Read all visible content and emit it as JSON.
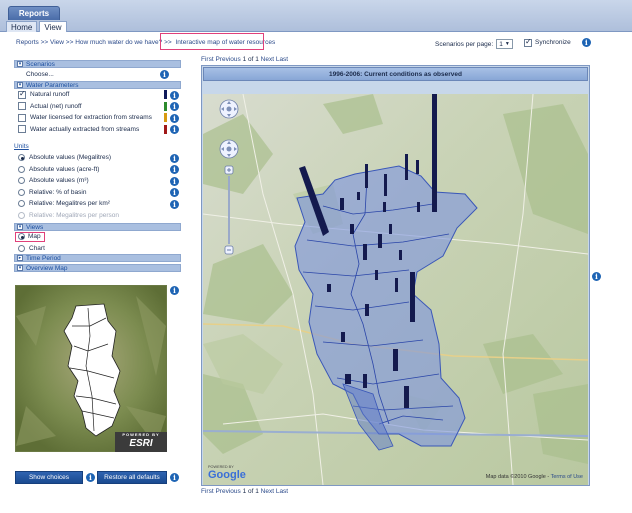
{
  "header": {
    "app_tab": "Reports",
    "tabs": [
      {
        "label": "Home"
      },
      {
        "label": "View"
      }
    ]
  },
  "breadcrumb": {
    "items": [
      "Reports",
      "View",
      "How much water do we have?"
    ],
    "separator": ">>",
    "current": "Interactive map of water resources"
  },
  "scenarios_per_page": {
    "label": "Scenarios per page:",
    "value": "1"
  },
  "synchronize": {
    "label": "Synchronize",
    "checked": true
  },
  "scenarios": {
    "title": "Scenarios",
    "choose_label": "Choose..."
  },
  "water_parameters": {
    "title": "Water Parameters",
    "items": [
      {
        "label": "Natural runoff",
        "checked": true,
        "color": "#101a5a"
      },
      {
        "label": "Actual (net) runoff",
        "checked": false,
        "color": "#2c8a2c"
      },
      {
        "label": "Water licensed for extraction from streams",
        "checked": false,
        "color": "#d89a10"
      },
      {
        "label": "Water actually extracted from streams",
        "checked": false,
        "color": "#a01818"
      }
    ]
  },
  "units": {
    "title": "Units",
    "items": [
      {
        "label": "Absolute values (Megalitres)",
        "selected": true,
        "enabled": true
      },
      {
        "label": "Absolute values (acre-ft)",
        "selected": false,
        "enabled": true
      },
      {
        "label": "Absolute values (m³)",
        "selected": false,
        "enabled": true
      },
      {
        "label": "Relative: % of basin",
        "selected": false,
        "enabled": true
      },
      {
        "label": "Relative: Megalitres per km²",
        "selected": false,
        "enabled": true
      },
      {
        "label": "Relative: Megalitres per person",
        "selected": false,
        "enabled": false
      }
    ]
  },
  "views": {
    "title": "Views",
    "items": [
      {
        "label": "Map",
        "selected": true
      },
      {
        "label": "Chart",
        "selected": false
      }
    ]
  },
  "time_period": {
    "title": "Time Period"
  },
  "overview_map": {
    "title": "Overview Map",
    "badge_small": "POWERED BY",
    "badge_logo": "ESRI"
  },
  "buttons": {
    "show_choices": "Show choices",
    "restore_defaults": "Restore all defaults"
  },
  "pager": {
    "first": "First",
    "previous": "Previous",
    "page_of": "1 of 1",
    "next": "Next",
    "last": "Last"
  },
  "map": {
    "title": "1996-2006: Current conditions as observed",
    "credit": "Map data ©2010  Google -",
    "terms": "Terms of Use",
    "powered_by": "POWERED BY",
    "logo": "Google"
  },
  "icons": {
    "info": "info-icon",
    "zoom": "zoom-control-icon",
    "pan": "pan-control-icon"
  }
}
